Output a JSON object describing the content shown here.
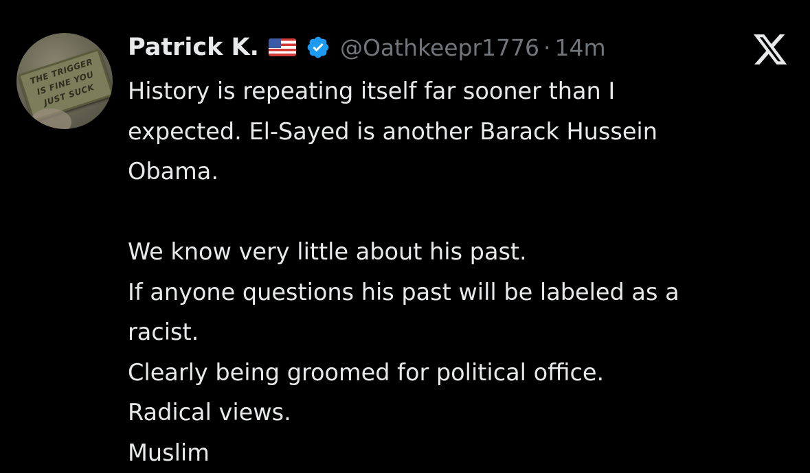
{
  "tweet": {
    "author": {
      "display_name": "Patrick K.",
      "flag_icon": "us-flag-icon",
      "verified_icon": "verified-badge-icon",
      "verified_color": "#1d9bf0",
      "handle": "@Oathkeepr1776",
      "separator": "·",
      "timestamp": "14m",
      "avatar": {
        "patch_line_1": "THE TRIGGER",
        "patch_line_2": "IS FINE YOU",
        "patch_line_3": "JUST SUCK"
      }
    },
    "platform_icon": "x-logo-icon",
    "text_lines": [
      "History is repeating itself far sooner than I",
      "expected. El-Sayed is another Barack Hussein",
      "Obama.",
      "",
      "We know very little about his past.",
      "If anyone questions his past will be labeled as a",
      "racist.",
      "Clearly being groomed for political office.",
      "Radical views.",
      "Muslim"
    ]
  },
  "colors": {
    "background": "#000000",
    "primary_text": "#e7e9ea",
    "secondary_text": "#71767b"
  }
}
